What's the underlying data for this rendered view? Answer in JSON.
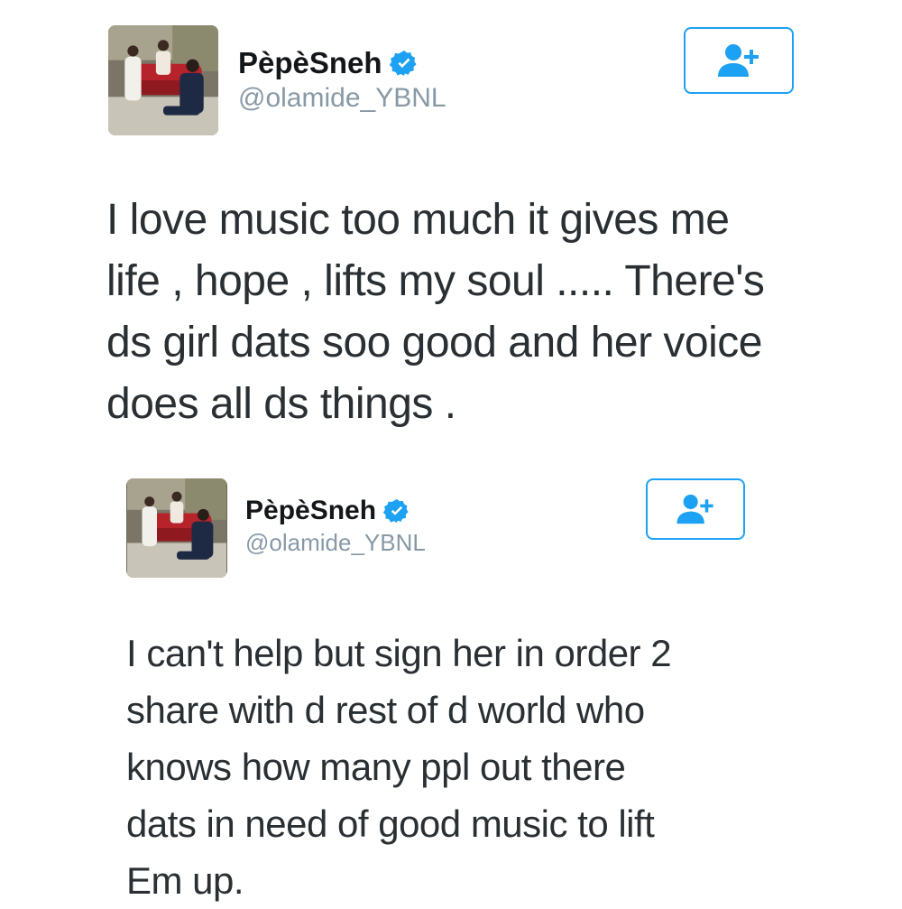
{
  "tweets": [
    {
      "display_name": "PèpèSneh",
      "handle": "@olamide_YBNL",
      "verified_icon": "verified-badge-icon",
      "follow_icon": "follow-user-plus-icon",
      "lines": [
        "I love music too much it gives me",
        "life , hope , lifts my soul ..... There's",
        "ds girl dats soo good and her voice",
        "does all ds things ."
      ]
    },
    {
      "display_name": "PèpèSneh",
      "handle": "@olamide_YBNL",
      "verified_icon": "verified-badge-icon",
      "follow_icon": "follow-user-plus-icon",
      "lines": [
        "I can't help but sign her in order 2",
        "share with d rest of d world who",
        "knows how many ppl out there",
        "dats in need of good music to lift",
        "Em up."
      ]
    }
  ],
  "colors": {
    "accent": "#1da1f2",
    "text": "#292f33",
    "handle": "#8899a6"
  }
}
